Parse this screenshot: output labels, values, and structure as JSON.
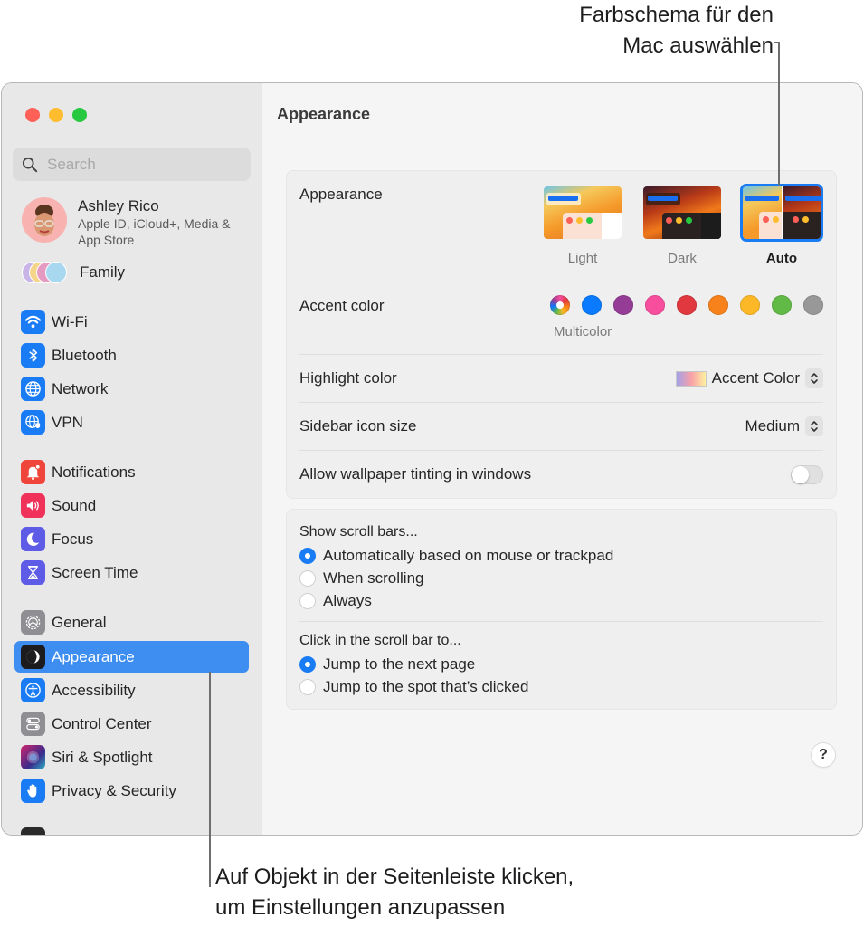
{
  "callouts": {
    "top_line1": "Farbschema für den",
    "top_line2": "Mac auswählen",
    "bottom_line1": "Auf Objekt in der Seitenleiste klicken,",
    "bottom_line2": "um Einstellungen anzupassen"
  },
  "window": {
    "traffic_lights": [
      "close",
      "minimize",
      "zoom"
    ]
  },
  "sidebar": {
    "search_placeholder": "Search",
    "profile": {
      "name": "Ashley Rico",
      "subtitle": "Apple ID, iCloud+, Media & App Store"
    },
    "family_label": "Family",
    "items": [
      {
        "label": "Wi-Fi",
        "icon": "wifi-icon",
        "color": "#1a7cf5"
      },
      {
        "label": "Bluetooth",
        "icon": "bluetooth-icon",
        "color": "#1a7cf5"
      },
      {
        "label": "Network",
        "icon": "globe-icon",
        "color": "#1a7cf5"
      },
      {
        "label": "VPN",
        "icon": "vpn-globe-shield-icon",
        "color": "#1a7cf5"
      },
      {
        "label": "Notifications",
        "icon": "bell-icon",
        "color": "#f0453a"
      },
      {
        "label": "Sound",
        "icon": "speaker-icon",
        "color": "#f0325b"
      },
      {
        "label": "Focus",
        "icon": "moon-icon",
        "color": "#5e5ce6"
      },
      {
        "label": "Screen Time",
        "icon": "hourglass-icon",
        "color": "#5e5ce6"
      },
      {
        "label": "General",
        "icon": "gear-icon",
        "color": "#8e8e93"
      },
      {
        "label": "Appearance",
        "icon": "appearance-icon",
        "color": "#1c1c1e",
        "active": true
      },
      {
        "label": "Accessibility",
        "icon": "accessibility-icon",
        "color": "#1a7cf5"
      },
      {
        "label": "Control Center",
        "icon": "toggles-icon",
        "color": "#8e8e93"
      },
      {
        "label": "Siri & Spotlight",
        "icon": "siri-icon",
        "color": "#8a2be2"
      },
      {
        "label": "Privacy & Security",
        "icon": "hand-icon",
        "color": "#1a7cf5"
      }
    ]
  },
  "main": {
    "title": "Appearance",
    "appearance": {
      "label": "Appearance",
      "options": [
        {
          "name": "Light",
          "selected": false
        },
        {
          "name": "Dark",
          "selected": false
        },
        {
          "name": "Auto",
          "selected": true
        }
      ]
    },
    "accent": {
      "label": "Accent color",
      "selected_caption": "Multicolor",
      "colors": [
        {
          "name": "Multicolor",
          "hex": "multicolor"
        },
        {
          "name": "Blue",
          "hex": "#0a7aff"
        },
        {
          "name": "Purple",
          "hex": "#953d96"
        },
        {
          "name": "Pink",
          "hex": "#f74f9e"
        },
        {
          "name": "Red",
          "hex": "#e0383e"
        },
        {
          "name": "Orange",
          "hex": "#f7821b"
        },
        {
          "name": "Yellow",
          "hex": "#fcb827"
        },
        {
          "name": "Green",
          "hex": "#62ba46"
        },
        {
          "name": "Graphite",
          "hex": "#989898"
        }
      ]
    },
    "highlight": {
      "label": "Highlight color",
      "value": "Accent Color"
    },
    "sidebar_icon_size": {
      "label": "Sidebar icon size",
      "value": "Medium"
    },
    "wallpaper_tinting": {
      "label": "Allow wallpaper tinting in windows",
      "enabled": false
    },
    "scroll_bars": {
      "heading": "Show scroll bars...",
      "options": [
        {
          "label": "Automatically based on mouse or trackpad",
          "selected": true
        },
        {
          "label": "When scrolling",
          "selected": false
        },
        {
          "label": "Always",
          "selected": false
        }
      ]
    },
    "click_scroll": {
      "heading": "Click in the scroll bar to...",
      "options": [
        {
          "label": "Jump to the next page",
          "selected": true
        },
        {
          "label": "Jump to the spot that’s clicked",
          "selected": false
        }
      ]
    },
    "help_label": "?"
  }
}
